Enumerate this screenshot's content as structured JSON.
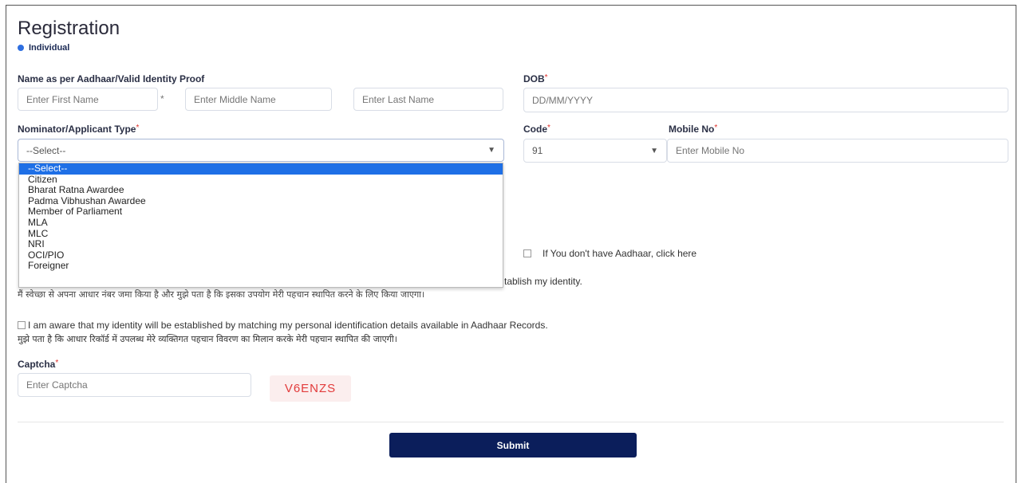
{
  "form": {
    "title": "Registration",
    "radio_individual": "Individual"
  },
  "name_section": {
    "label": "Name as per Aadhaar/Valid Identity Proof",
    "first_placeholder": "Enter First Name",
    "star": "*",
    "middle_placeholder": "Enter Middle Name",
    "last_placeholder": "Enter Last Name"
  },
  "dob": {
    "label": "DOB",
    "req": "*",
    "placeholder": "DD/MM/YYYY"
  },
  "nominator": {
    "label": "Nominator/Applicant Type",
    "req": "*",
    "selected": "--Select--",
    "options": [
      "--Select--",
      "Citizen",
      "Bharat Ratna Awardee",
      "Padma Vibhushan Awardee",
      "Member of Parliament",
      "MLA",
      "MLC",
      "NRI",
      "OCI/PIO",
      "Foreigner"
    ]
  },
  "code": {
    "label": "Code",
    "req": "*",
    "value": "91"
  },
  "mobile": {
    "label": "Mobile No",
    "req": "*",
    "placeholder": "Enter Mobile No"
  },
  "aadhaar": {
    "no_aadhaar_text": "If You don't have Aadhaar, click here",
    "consent1_tail": "tablish my identity.",
    "consent1_hindi": "मैं स्वेच्छा से अपना आधार नंबर जमा किया है और मुझे पता है कि इसका उपयोग मेरी पहचान स्थापित करने के लिए किया जाएगा।",
    "consent2_en": "I am aware that my identity will be established by matching my personal identification details available in Aadhaar Records.",
    "consent2_hindi": "मुझे पता है कि आधार रिकॉर्ड में उपलब्ध मेरे व्यक्तिगत पहचान विवरण का मिलान करके मेरी पहचान स्थापित की जाएगी।"
  },
  "captcha": {
    "label": "Captcha",
    "req": "*",
    "placeholder": "Enter Captcha",
    "code": "V6ENZS"
  },
  "submit_label": "Submit"
}
